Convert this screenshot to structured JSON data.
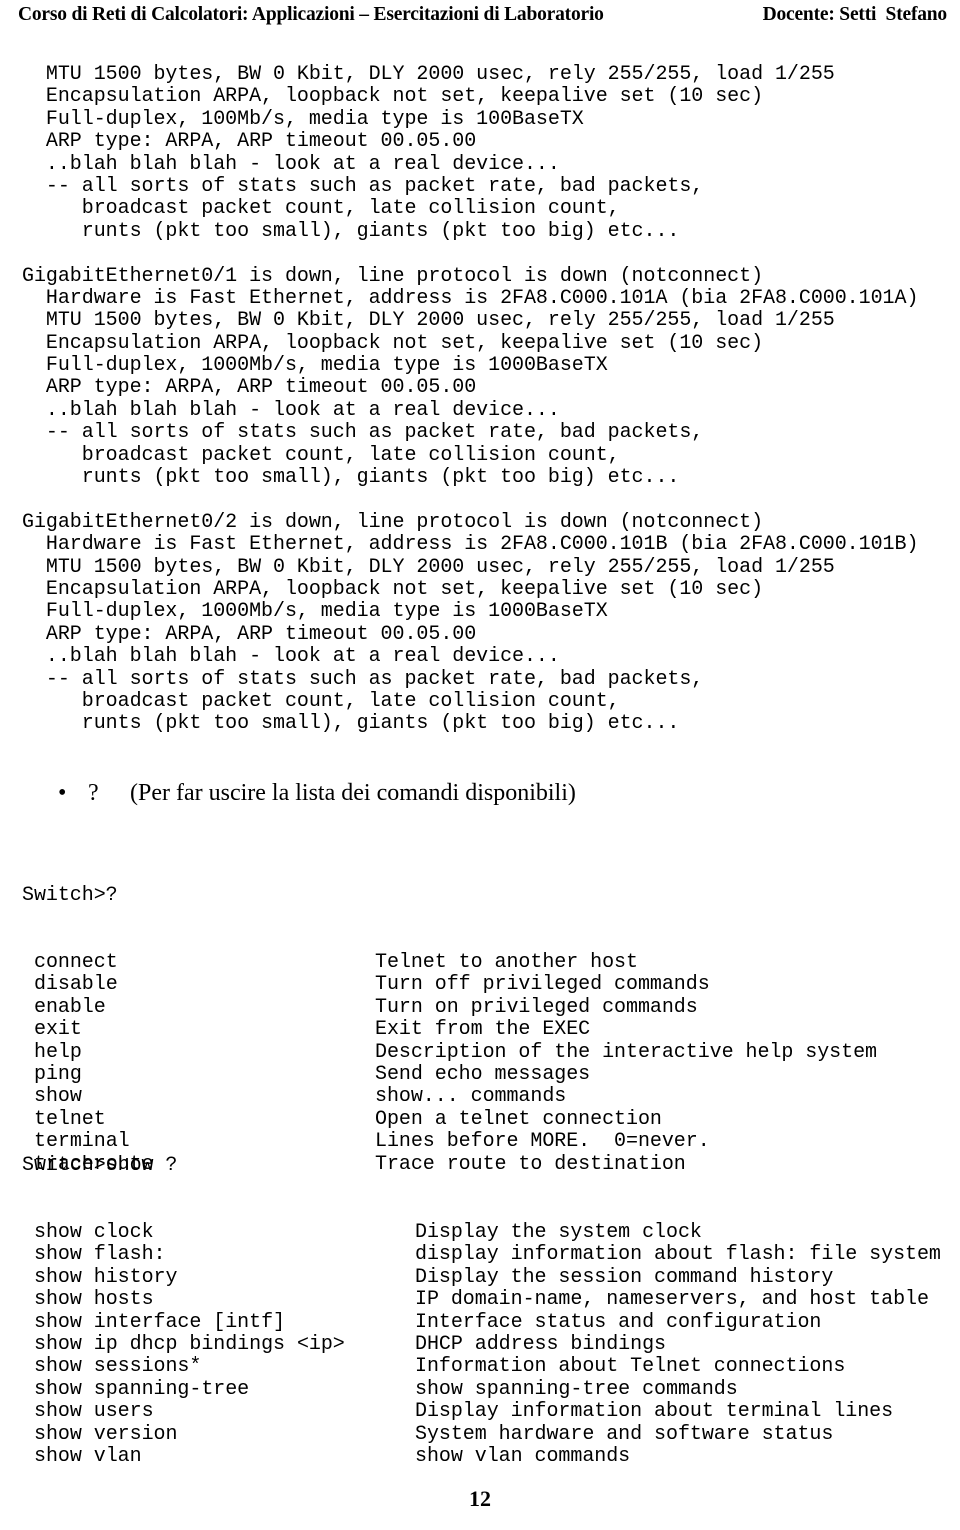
{
  "header": {
    "course_title": "Corso di Reti di Calcolatori: Applicazioni – Esercitazioni di Laboratorio",
    "instructor": "Docente: Setti  Stefano"
  },
  "terminal_top": {
    "lines": [
      "  MTU 1500 bytes, BW 0 Kbit, DLY 2000 usec, rely 255/255, load 1/255",
      "  Encapsulation ARPA, loopback not set, keepalive set (10 sec)",
      "  Full-duplex, 100Mb/s, media type is 100BaseTX",
      "  ARP type: ARPA, ARP timeout 00.05.00",
      "  ..blah blah blah - look at a real device...",
      "  -- all sorts of stats such as packet rate, bad packets,",
      "     broadcast packet count, late collision count,",
      "     runts (pkt too small), giants (pkt too big) etc...",
      "",
      "GigabitEthernet0/1 is down, line protocol is down (notconnect)",
      "  Hardware is Fast Ethernet, address is 2FA8.C000.101A (bia 2FA8.C000.101A)",
      "  MTU 1500 bytes, BW 0 Kbit, DLY 2000 usec, rely 255/255, load 1/255",
      "  Encapsulation ARPA, loopback not set, keepalive set (10 sec)",
      "  Full-duplex, 1000Mb/s, media type is 1000BaseTX",
      "  ARP type: ARPA, ARP timeout 00.05.00",
      "  ..blah blah blah - look at a real device...",
      "  -- all sorts of stats such as packet rate, bad packets,",
      "     broadcast packet count, late collision count,",
      "     runts (pkt too small), giants (pkt too big) etc...",
      "",
      "GigabitEthernet0/2 is down, line protocol is down (notconnect)",
      "  Hardware is Fast Ethernet, address is 2FA8.C000.101B (bia 2FA8.C000.101B)",
      "  MTU 1500 bytes, BW 0 Kbit, DLY 2000 usec, rely 255/255, load 1/255",
      "  Encapsulation ARPA, loopback not set, keepalive set (10 sec)",
      "  Full-duplex, 1000Mb/s, media type is 1000BaseTX",
      "  ARP type: ARPA, ARP timeout 00.05.00",
      "  ..blah blah blah - look at a real device...",
      "  -- all sorts of stats such as packet rate, bad packets,",
      "     broadcast packet count, late collision count,",
      "     runts (pkt too small), giants (pkt too big) etc..."
    ]
  },
  "bullet": {
    "marker": "•",
    "question_mark": "?",
    "text": "(Per far uscire la lista dei comandi disponibili)"
  },
  "basic_help": {
    "prompt": "Switch>?",
    "rows": [
      {
        "command": "connect",
        "description": "Telnet to another host"
      },
      {
        "command": "disable",
        "description": "Turn off privileged commands"
      },
      {
        "command": "enable",
        "description": "Turn on privileged commands"
      },
      {
        "command": "exit",
        "description": "Exit from the EXEC"
      },
      {
        "command": "help",
        "description": "Description of the interactive help system"
      },
      {
        "command": "ping",
        "description": "Send echo messages"
      },
      {
        "command": "show",
        "description": "show... commands"
      },
      {
        "command": "telnet",
        "description": "Open a telnet connection"
      },
      {
        "command": "terminal",
        "description": "Lines before MORE.  0=never."
      },
      {
        "command": "traceroute",
        "description": "Trace route to destination"
      }
    ]
  },
  "show_help": {
    "prompt": "Switch>show ?",
    "rows": [
      {
        "command": "show clock",
        "description": "Display the system clock"
      },
      {
        "command": "show flash:",
        "description": "display information about flash: file system"
      },
      {
        "command": "show history",
        "description": "Display the session command history"
      },
      {
        "command": "show hosts",
        "description": "IP domain-name, nameservers, and host table"
      },
      {
        "command": "show interface [intf]",
        "description": "Interface status and configuration"
      },
      {
        "command": "show ip dhcp bindings <ip>",
        "description": "DHCP address bindings"
      },
      {
        "command": "show sessions*",
        "description": "Information about Telnet connections"
      },
      {
        "command": "show spanning-tree",
        "description": "show spanning-tree commands"
      },
      {
        "command": "show users",
        "description": "Display information about terminal lines"
      },
      {
        "command": "show version",
        "description": "System hardware and software status"
      },
      {
        "command": "show vlan",
        "description": "show vlan commands"
      }
    ]
  },
  "footer": {
    "page_number": "12"
  }
}
